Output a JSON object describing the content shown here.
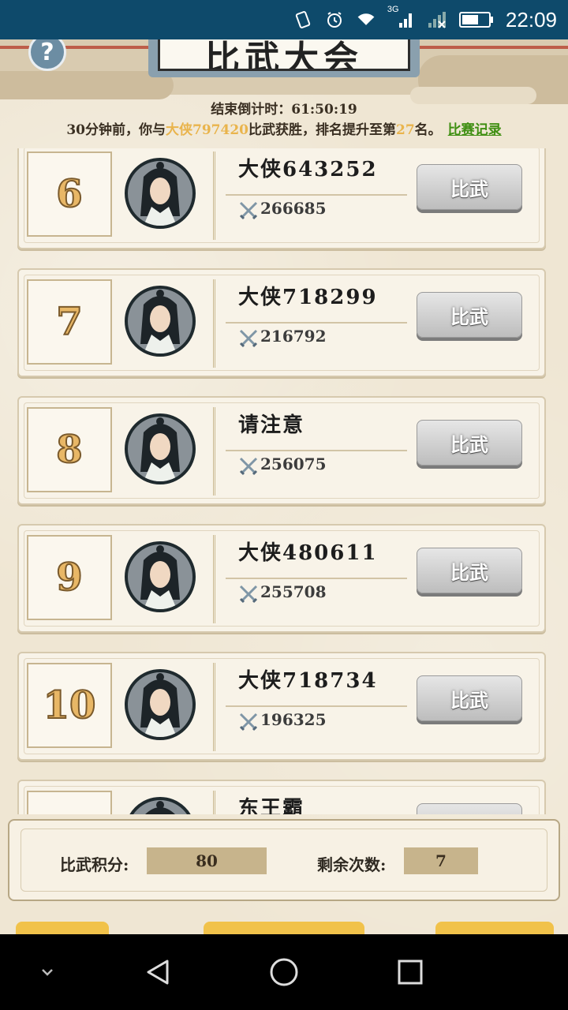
{
  "status_bar": {
    "time": "22:09",
    "network_label": "3G",
    "icons": [
      "vibrate-icon",
      "alarm-icon",
      "wifi-icon",
      "cellular-signal-icon",
      "no-signal-icon",
      "battery-icon"
    ]
  },
  "header": {
    "title": "比武大会",
    "help_label": "?",
    "countdown_label": "结束倒计时：",
    "countdown_value": "61:50:19",
    "notice_prefix": "30分钟前，你与",
    "notice_opponent": "大侠797420",
    "notice_mid": "比武获胜，排名提升至第",
    "notice_rank": "27",
    "notice_suffix": "名。",
    "record_link": "比赛记录"
  },
  "ranking_list": [
    {
      "rank": "6",
      "name": "大侠643252",
      "power": "266685",
      "button": "比武"
    },
    {
      "rank": "7",
      "name": "大侠718299",
      "power": "216792",
      "button": "比武"
    },
    {
      "rank": "8",
      "name": "请注意",
      "power": "256075",
      "button": "比武"
    },
    {
      "rank": "9",
      "name": "大侠480611",
      "power": "255708",
      "button": "比武"
    },
    {
      "rank": "10",
      "name": "大侠718734",
      "power": "196325",
      "button": "比武"
    },
    {
      "rank": "",
      "name": "东王霸",
      "power": "",
      "button": ""
    }
  ],
  "stats": {
    "score_label": "比武积分:",
    "score_value": "80",
    "remaining_label": "剩余次数:",
    "remaining_value": "7"
  },
  "colors": {
    "status_bar": "#0e4a6b",
    "highlight": "#e9b44c",
    "link": "#3f8f12",
    "button_gray": "#bdbdbd"
  }
}
